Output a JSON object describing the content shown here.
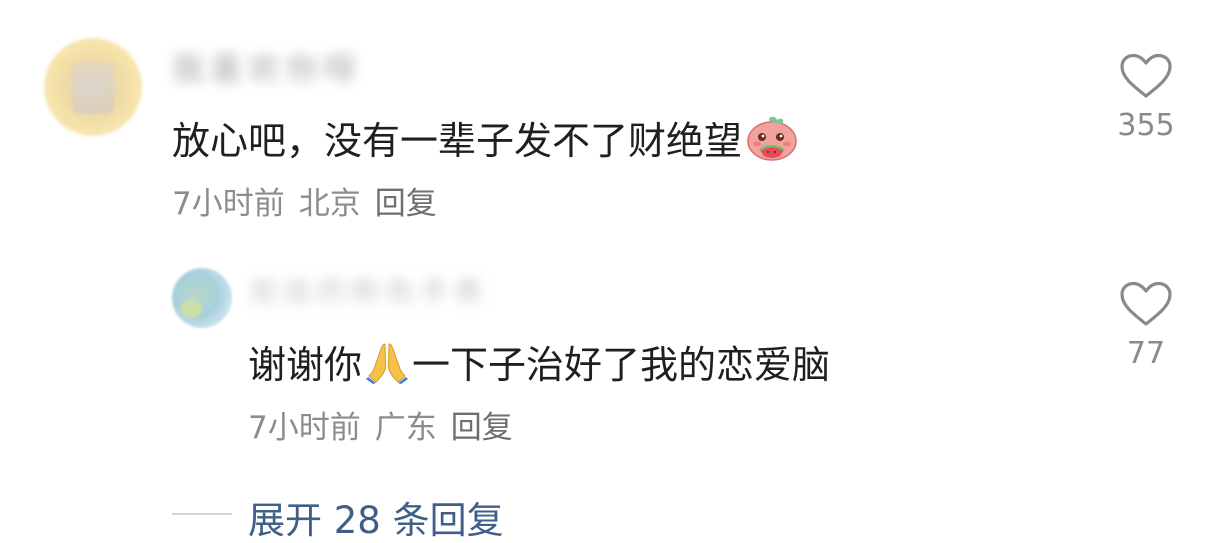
{
  "comment": {
    "author_name": "我喜欢你呀",
    "text_before_emoji": "放心吧，没有一辈子发不了财绝望",
    "emoji": "peach-eating-watermelon-emoji",
    "time": "7小时前",
    "location": "北京",
    "reply_label": "回复",
    "likes": "355"
  },
  "reply": {
    "author_name": "拾拾的粉色手表",
    "text_before_emoji": "谢谢你",
    "emoji": "folded-hands-emoji",
    "text_after_emoji": "一下子治好了我的恋爱脑",
    "time": "7小时前",
    "location": "广东",
    "reply_label": "回复",
    "likes": "77"
  },
  "expand_replies": "展开 28 条回复",
  "icons": {
    "like": "heart-outline-icon"
  },
  "colors": {
    "text": "#1f1f1f",
    "meta": "#8c8c8c",
    "link": "#3f5f88"
  }
}
